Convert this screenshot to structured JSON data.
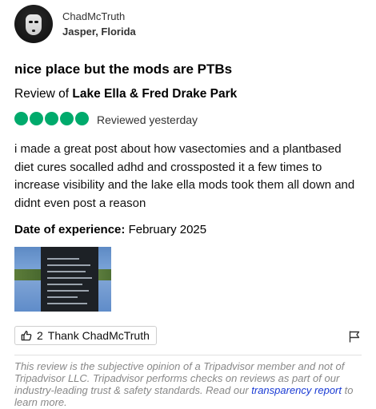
{
  "user": {
    "name": "ChadMcTruth",
    "location": "Jasper, Florida"
  },
  "review": {
    "title": "nice place but the mods are PTBs",
    "review_of_prefix": "Review of ",
    "place": "Lake Ella & Fred Drake Park",
    "rating": 5,
    "reviewed_when": "Reviewed yesterday",
    "body": "i made a great post about how vasectomies and a plantbased diet cures socalled adhd and crossposted it a few times to increase visibility and the lake ella mods took them all down and didnt even post a reason",
    "experience_label": "Date of experience:",
    "experience_date": "February 2025"
  },
  "actions": {
    "thank_count": "2",
    "thank_label": "Thank ChadMcTruth"
  },
  "disclaimer": {
    "text": "This review is the subjective opinion of a Tripadvisor member and not of Tripadvisor LLC. Tripadvisor performs checks on reviews as part of our industry-leading trust & safety standards. Read our ",
    "link": "transparency report",
    "suffix": " to learn more."
  },
  "colors": {
    "rating_bubble": "#00aa6c",
    "link": "#1a3bd4"
  }
}
